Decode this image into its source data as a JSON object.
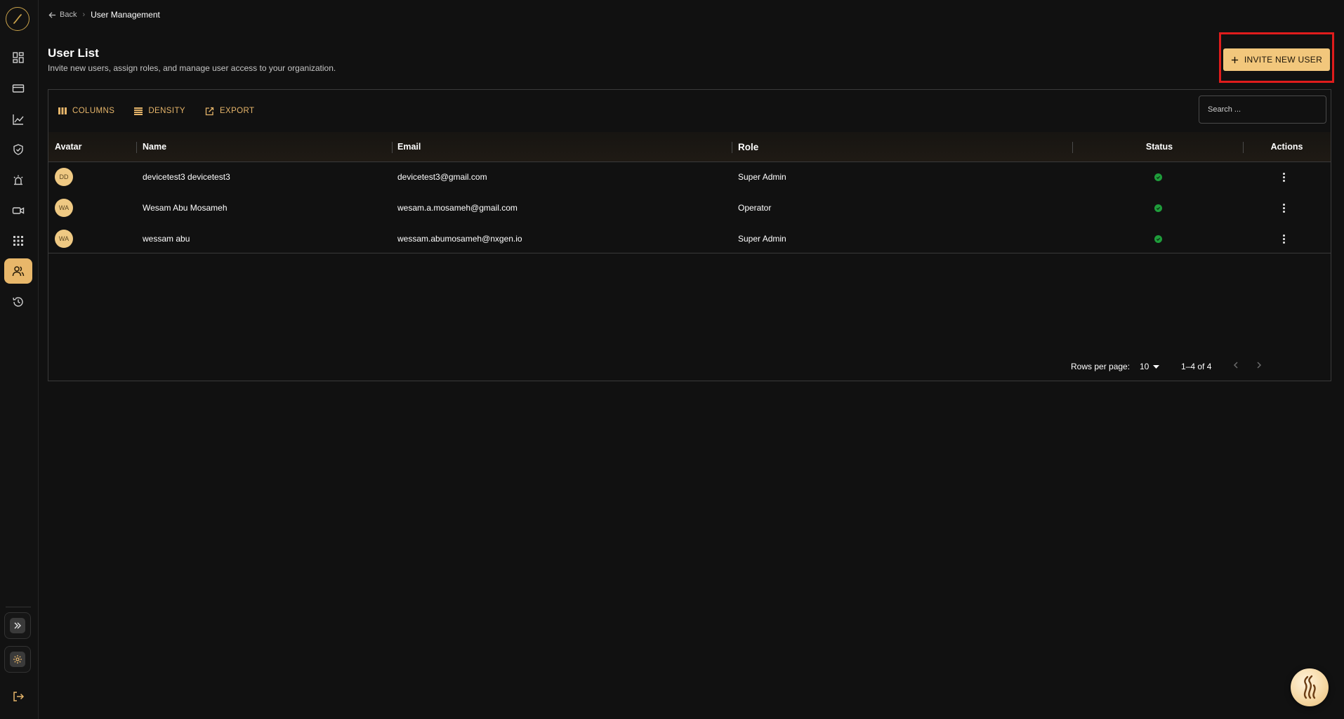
{
  "breadcrumb": {
    "back_label": "Back",
    "current": "User Management"
  },
  "page": {
    "title": "User List",
    "subtitle": "Invite new users, assign roles, and manage user access to your organization."
  },
  "invite_button": {
    "label": "INVITE NEW USER"
  },
  "toolbar": {
    "columns": "COLUMNS",
    "density": "DENSITY",
    "export": "EXPORT"
  },
  "search": {
    "placeholder": "Search ..."
  },
  "table": {
    "headers": {
      "avatar": "Avatar",
      "name": "Name",
      "email": "Email",
      "role": "Role",
      "status": "Status",
      "actions": "Actions"
    },
    "rows": [
      {
        "initials": "DD",
        "name": "devicetest3 devicetest3",
        "email": "devicetest3@gmail.com",
        "role": "Super Admin",
        "status": "active"
      },
      {
        "initials": "WA",
        "name": "Wesam Abu Mosameh",
        "email": "wesam.a.mosameh@gmail.com",
        "role": "Operator",
        "status": "active"
      },
      {
        "initials": "WA",
        "name": "wessam abu",
        "email": "wessam.abumosameh@nxgen.io",
        "role": "Super Admin",
        "status": "active"
      }
    ]
  },
  "pagination": {
    "rows_per_page_label": "Rows per page:",
    "rows_per_page": "10",
    "range": "1–4 of 4"
  },
  "sidebar": {
    "items": [
      {
        "icon": "dashboard-icon"
      },
      {
        "icon": "card-icon"
      },
      {
        "icon": "analytics-icon"
      },
      {
        "icon": "shield-icon"
      },
      {
        "icon": "alarm-icon"
      },
      {
        "icon": "camera-icon"
      },
      {
        "icon": "grid-icon"
      },
      {
        "icon": "users-icon",
        "active": true
      },
      {
        "icon": "history-icon"
      }
    ]
  },
  "colors": {
    "accent": "#f2c77c",
    "highlight": "#e01c1c",
    "status_ok": "#1f9d3b",
    "background": "#111111"
  }
}
